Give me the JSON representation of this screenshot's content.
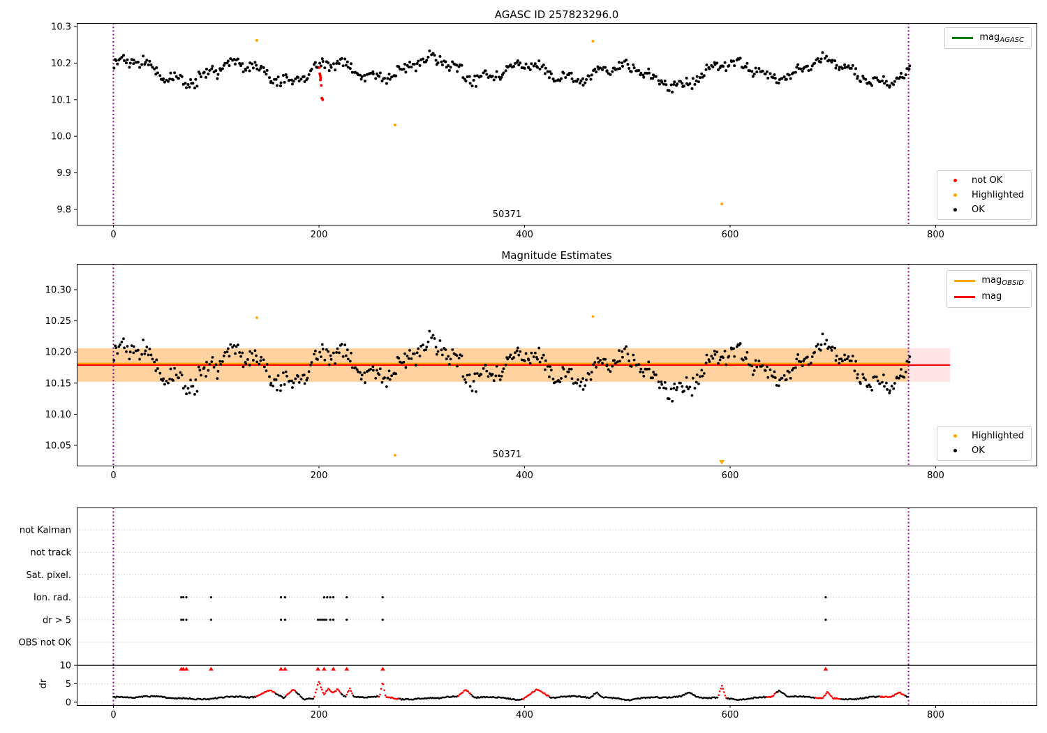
{
  "colors": {
    "background": "#ffffff",
    "axis": "#000000",
    "ok_point": "#000000",
    "not_ok_point": "#ff0000",
    "highlight_point": "#ffa500",
    "agasc_line": "#008000",
    "mag_line": "#ff0000",
    "obsid_line": "#ffa500",
    "band_fill": "rgba(255,0,0,0.10)",
    "obsid_band_fill": "rgba(255,165,0,0.30)",
    "vline": "#8b008b",
    "gridline": "#bbbbbb"
  },
  "chart_data": [
    {
      "type": "scatter",
      "title": "AGASC ID 257823296.0",
      "xticks": {
        "values": [
          0,
          200,
          400,
          600,
          800
        ],
        "labels": [
          "0",
          "200",
          "400",
          "600",
          "800"
        ]
      },
      "yticks": {
        "values": [
          10.3,
          10.2,
          10.1,
          10.0,
          9.9,
          9.8
        ],
        "labels": [
          "10.3",
          "10.2",
          "10.1",
          "10.0",
          "9.9",
          "9.8"
        ]
      },
      "ylim": [
        9.758,
        10.309
      ],
      "xlim": [
        -36,
        898
      ],
      "vlines": [
        0,
        773.6
      ],
      "annotation": {
        "label": "50371",
        "x": 383
      },
      "legend_line": {
        "main": "mag",
        "sub": "AGASC",
        "color": "#008000"
      },
      "legend_points": [
        {
          "label": "not OK",
          "color": "#ff0000"
        },
        {
          "label": "Highlighted",
          "color": "#ffa500"
        },
        {
          "label": "OK",
          "color": "#000000"
        }
      ],
      "ok_series_spec": {
        "n": 570,
        "x_range": [
          0,
          775
        ],
        "mean": 10.175,
        "noise": 0.019,
        "clip": [
          10.108,
          10.252
        ],
        "seed": 20240
      },
      "not_ok_points": [
        [
          200.3,
          10.188
        ],
        [
          200.8,
          10.171
        ],
        [
          201.2,
          10.166
        ],
        [
          201.6,
          10.16
        ],
        [
          201.4,
          10.154
        ],
        [
          202.2,
          10.139
        ],
        [
          202.8,
          10.104
        ],
        [
          203.6,
          10.1
        ]
      ],
      "highlighted_points": [
        [
          139.5,
          10.262
        ],
        [
          274,
          10.031
        ],
        [
          466.5,
          10.26
        ],
        [
          592,
          9.815
        ]
      ]
    },
    {
      "type": "scatter",
      "title": "Magnitude Estimates",
      "xticks": {
        "values": [
          0,
          200,
          400,
          600,
          800
        ],
        "labels": [
          "0",
          "200",
          "400",
          "600",
          "800"
        ]
      },
      "yticks": {
        "values": [
          10.3,
          10.25,
          10.2,
          10.15,
          10.1,
          10.05
        ],
        "labels": [
          "10.30",
          "10.25",
          "10.20",
          "10.15",
          "10.10",
          "10.05"
        ]
      },
      "ylim": [
        10.017,
        10.341
      ],
      "xlim": [
        -36,
        898
      ],
      "vlines": [
        0,
        773.6
      ],
      "annotation": {
        "label": "50371",
        "x": 383
      },
      "mag_line": {
        "value": 10.179,
        "x_end": 814
      },
      "band": {
        "low": 10.152,
        "high": 10.206,
        "x_end": 814
      },
      "obsid_line": {
        "value": 10.181,
        "x_end": 773.6
      },
      "legend_lines": [
        {
          "main": "mag",
          "sub": "OBSID",
          "color": "#ffa500"
        },
        {
          "main": "mag",
          "sub": "",
          "color": "#ff0000"
        }
      ],
      "legend_points": [
        {
          "label": "Highlighted",
          "color": "#ffa500"
        },
        {
          "label": "OK",
          "color": "#000000"
        }
      ],
      "highlighted_points": [
        [
          139.5,
          10.255
        ],
        [
          274,
          10.034
        ],
        [
          466.5,
          10.257
        ]
      ],
      "clipped_below_markers": [
        592
      ]
    },
    {
      "type": "scatter",
      "title": "",
      "rows": [
        "not Kalman",
        "not track",
        "Sat. pixel.",
        "Ion. rad.",
        "dr > 5",
        "OBS not OK"
      ],
      "xticks": {
        "values": [
          0,
          200,
          400,
          600,
          800
        ],
        "labels": [
          "0",
          "200",
          "400",
          "600",
          "800"
        ]
      },
      "vlines": [
        0,
        773.6
      ],
      "flags": {
        "ion_rad": [
          66,
          68,
          71,
          95,
          163,
          167,
          205,
          208,
          211,
          214,
          227,
          262,
          693
        ],
        "dr_gt_5": [
          66,
          68,
          71,
          95,
          163,
          167,
          199,
          201,
          203,
          205,
          207,
          211,
          214,
          227,
          262,
          693
        ]
      },
      "dr_over_10_markers": [
        66,
        68,
        71,
        95,
        163,
        167,
        199,
        205,
        214,
        227,
        262,
        693
      ],
      "dr_axis": {
        "label": "dr",
        "tick_values": [
          10,
          5,
          0
        ],
        "tick_labels": [
          "10",
          "5",
          "0"
        ]
      },
      "dr_series_spec": {
        "n": 740,
        "x_range": [
          0,
          773
        ],
        "seed": 909,
        "base": 0.85,
        "noise": 0.3,
        "bumps": [
          [
            152,
            14,
            1.8
          ],
          [
            175,
            10,
            2.6
          ],
          [
            200,
            5,
            4.8
          ],
          [
            209,
            7,
            2.6
          ],
          [
            218,
            6,
            2.2
          ],
          [
            230,
            4,
            2.2
          ],
          [
            262,
            3,
            4.2
          ],
          [
            343,
            8,
            1.9
          ],
          [
            412,
            14,
            2.3
          ],
          [
            470,
            6,
            1.4
          ],
          [
            560,
            8,
            1.1
          ],
          [
            592,
            4,
            3.4
          ],
          [
            648,
            8,
            1.9
          ],
          [
            695,
            5,
            1.8
          ],
          [
            764,
            8,
            1.3
          ]
        ],
        "red_ranges": [
          [
            139,
            157
          ],
          [
            168,
            177
          ],
          [
            195,
            221
          ],
          [
            226,
            233
          ],
          [
            258,
            278
          ],
          [
            335,
            348
          ],
          [
            398,
            424
          ],
          [
            588,
            597
          ],
          [
            635,
            645
          ],
          [
            682,
            708
          ],
          [
            745,
            770
          ]
        ]
      }
    }
  ]
}
